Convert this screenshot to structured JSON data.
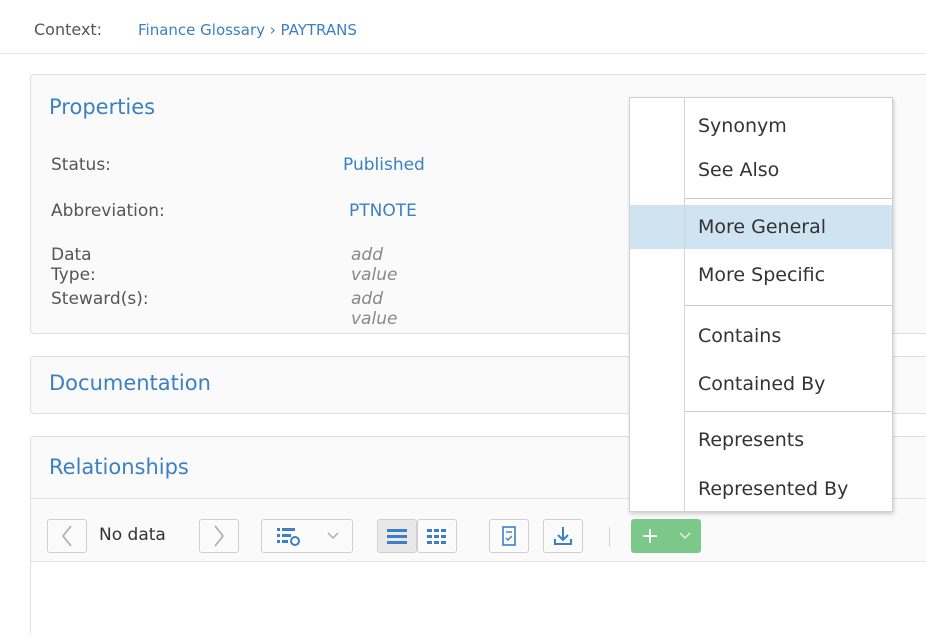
{
  "context": {
    "label": "Context:",
    "path": "Finance Glossary › PAYTRANS"
  },
  "properties": {
    "title": "Properties",
    "rows": [
      {
        "key": "Status:",
        "value": "Published"
      },
      {
        "key": "Abbreviation:",
        "value": "PTNOTE"
      },
      {
        "key": "Data Type:",
        "value": "add value"
      },
      {
        "key": "Steward(s):",
        "value": "add value"
      }
    ]
  },
  "documentation": {
    "title": "Documentation"
  },
  "relationships": {
    "title": "Relationships",
    "pager_text": "No data",
    "add_symbol": "+"
  },
  "menu": {
    "items": [
      "Synonym",
      "See Also",
      "More General",
      "More Specific",
      "Contains",
      "Contained By",
      "Represents",
      "Represented By"
    ],
    "highlighted": "More General"
  },
  "colors": {
    "link": "#3b7fc4",
    "highlight": "#cfe3f1",
    "add_button": "#7cc88a"
  },
  "icons": [
    "chevron-left-icon",
    "chevron-right-icon",
    "column-settings-icon",
    "list-view-icon",
    "grid-view-icon",
    "checklist-icon",
    "download-icon",
    "chevron-down-icon"
  ]
}
